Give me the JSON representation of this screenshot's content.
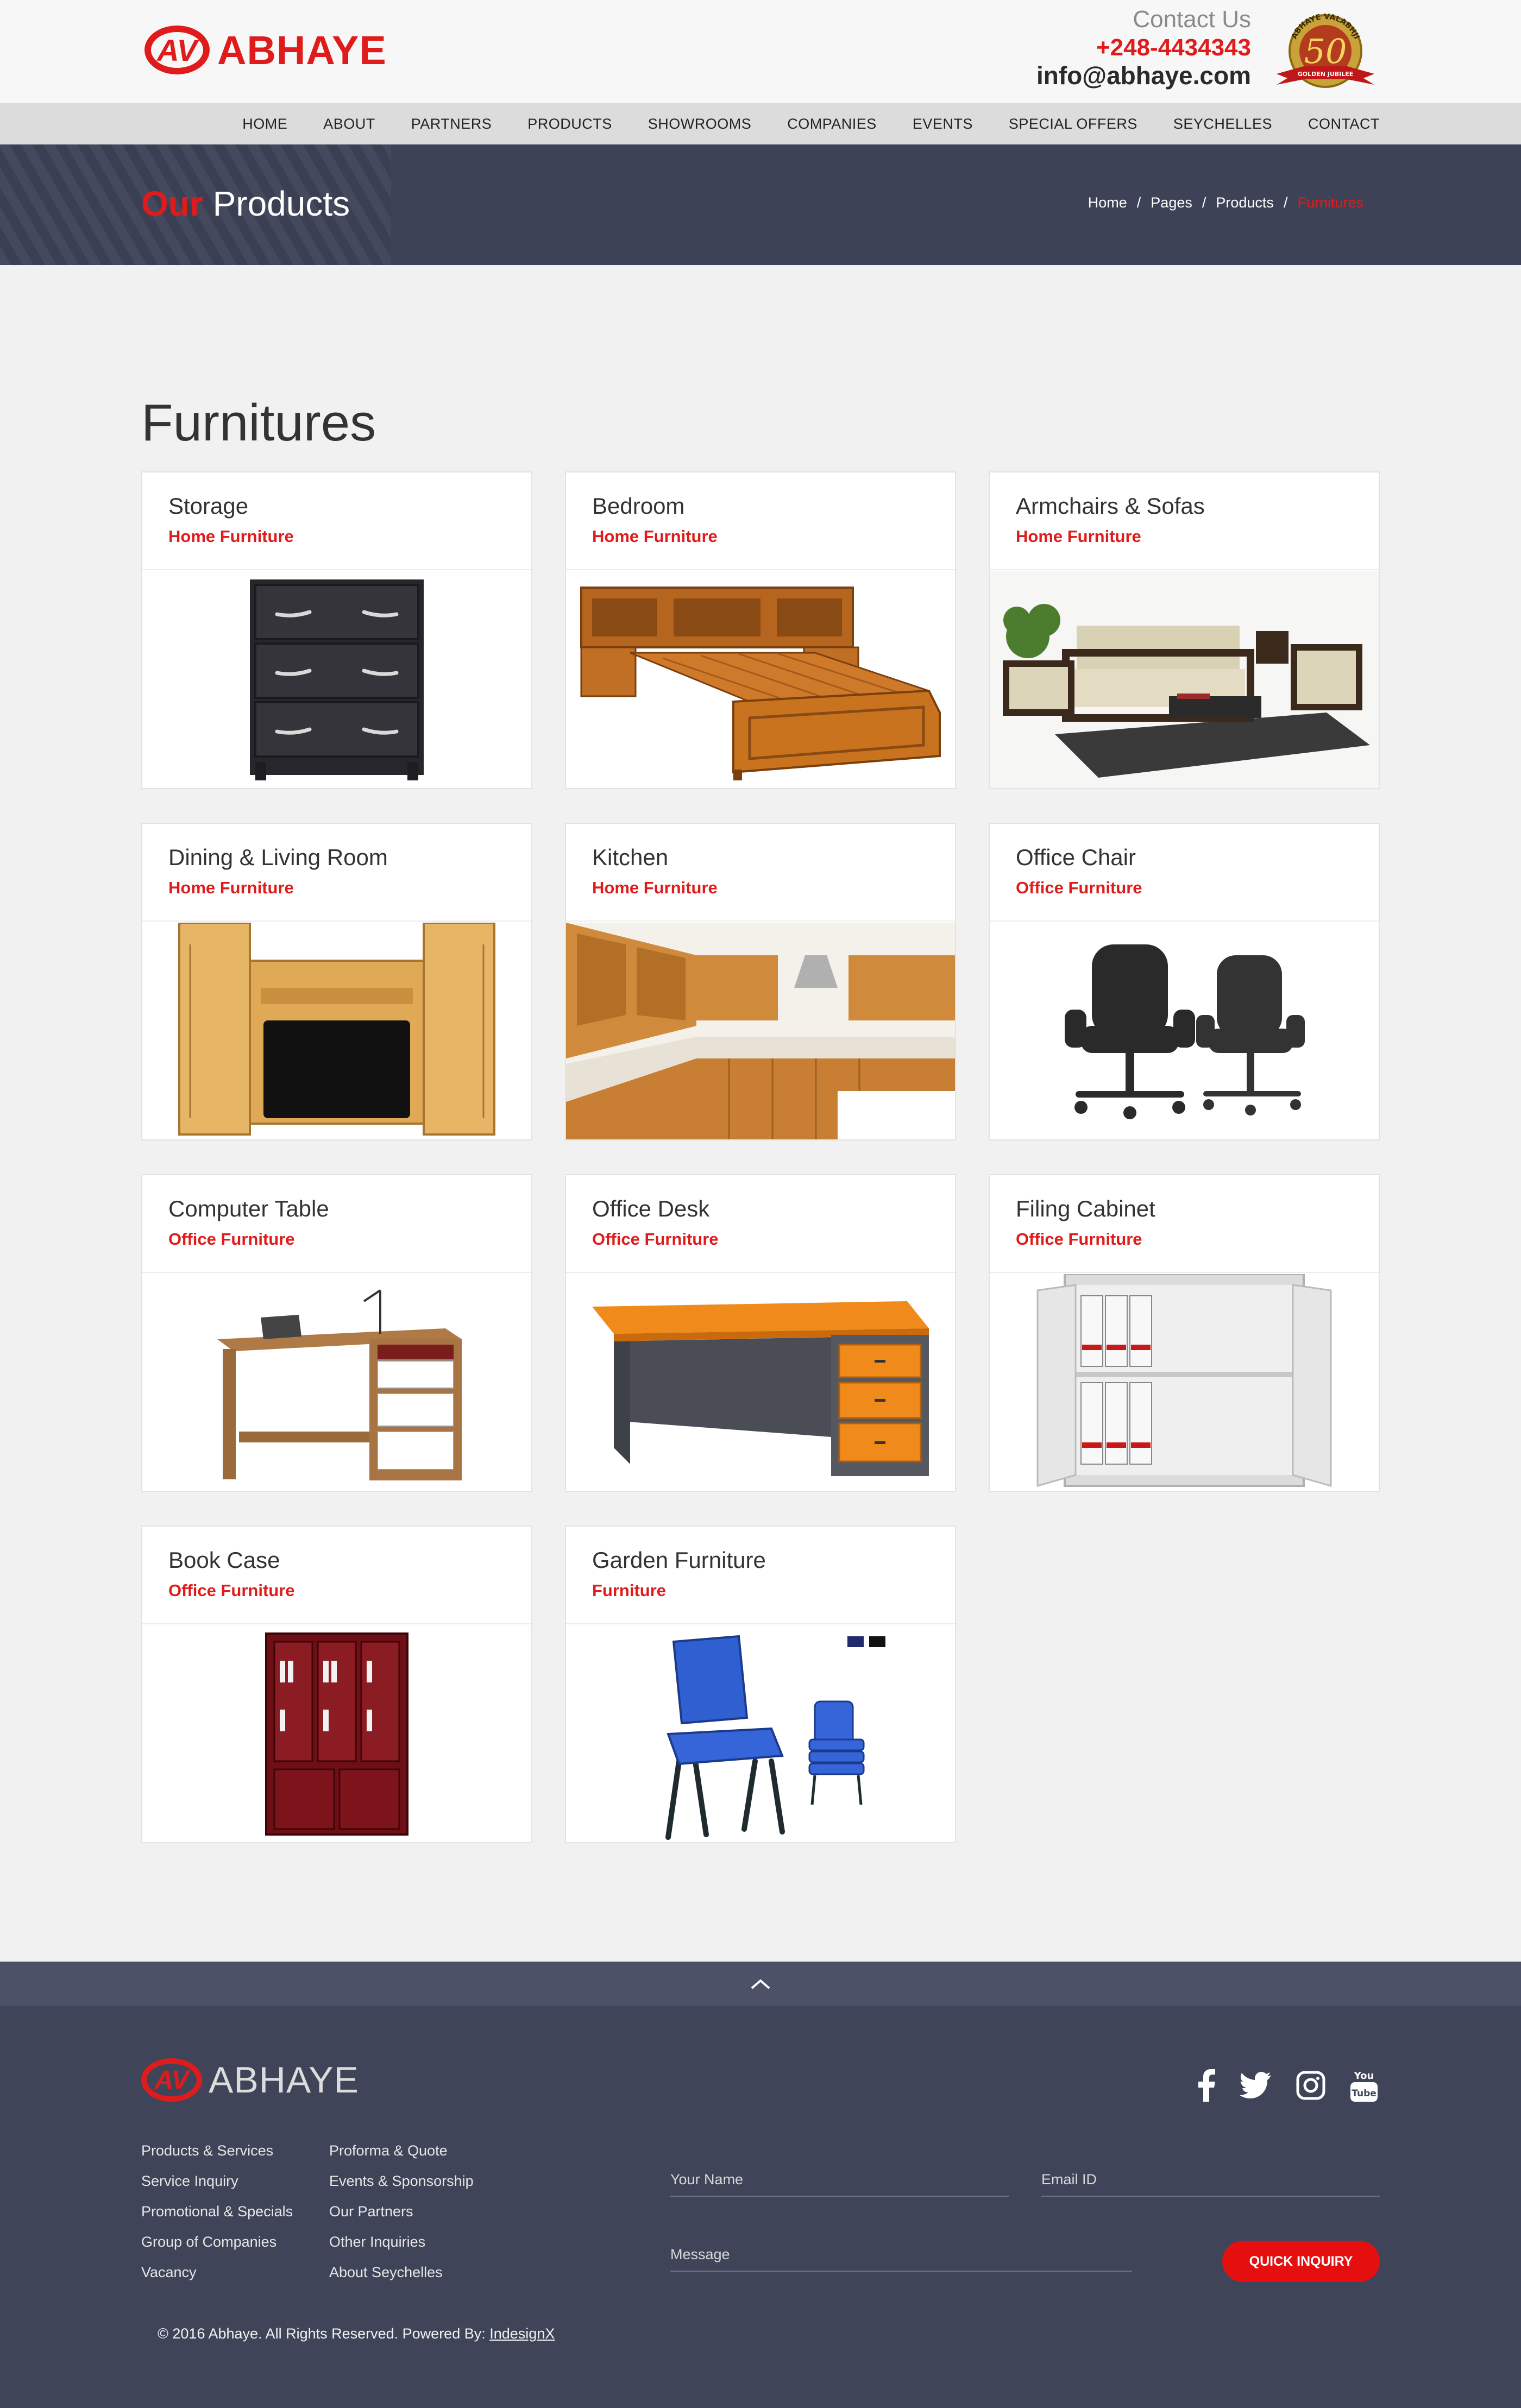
{
  "brand": {
    "name": "ABHAYE",
    "mark": "AV"
  },
  "contact": {
    "title": "Contact Us",
    "phone": "+248-4434343",
    "email": "info@abhaye.com"
  },
  "jubilee": {
    "top": "ABHAYE VALABHJI",
    "number": "50",
    "ribbon": "GOLDEN JUBILEE"
  },
  "nav": [
    "HOME",
    "ABOUT",
    "PARTNERS",
    "PRODUCTS",
    "SHOWROOMS",
    "COMPANIES",
    "EVENTS",
    "SPECIAL OFFERS",
    "SEYCHELLES",
    "CONTACT"
  ],
  "banner": {
    "title_accent": "Our",
    "title_rest": "Products",
    "breadcrumb": [
      "Home",
      "Pages",
      "Products",
      "Furnitures"
    ]
  },
  "section_title": "Furnitures",
  "products": [
    {
      "title": "Storage",
      "category": "Home Furniture",
      "image": "dresser"
    },
    {
      "title": "Bedroom",
      "category": "Home Furniture",
      "image": "bed"
    },
    {
      "title": "Armchairs & Sofas",
      "category": "Home Furniture",
      "image": "sofa-set"
    },
    {
      "title": "Dining & Living Room",
      "category": "Home Furniture",
      "image": "tv-unit"
    },
    {
      "title": "Kitchen",
      "category": "Home Furniture",
      "image": "kitchen"
    },
    {
      "title": "Office Chair",
      "category": "Office Furniture",
      "image": "office-chairs"
    },
    {
      "title": "Computer Table",
      "category": "Office Furniture",
      "image": "computer-table"
    },
    {
      "title": "Office Desk",
      "category": "Office Furniture",
      "image": "office-desk"
    },
    {
      "title": "Filing Cabinet",
      "category": "Office Furniture",
      "image": "filing-cabinet"
    },
    {
      "title": "Book Case",
      "category": "Office Furniture",
      "image": "book-case"
    },
    {
      "title": "Garden Furniture",
      "category": "Furniture",
      "image": "garden-chair"
    }
  ],
  "footer": {
    "links_col1": [
      "Products & Services",
      "Service Inquiry",
      "Promotional & Specials",
      "Group of Companies",
      "Vacancy"
    ],
    "links_col2": [
      "Proforma & Quote",
      "Events & Sponsorship",
      "Our Partners",
      "Other Inquiries",
      "About Seychelles"
    ],
    "social": [
      "facebook-icon",
      "twitter-icon",
      "instagram-icon",
      "youtube-icon"
    ],
    "youtube_label": "You Tube",
    "form": {
      "name_placeholder": "Your Name",
      "email_placeholder": "Email ID",
      "message_placeholder": "Message",
      "submit_label": "QUICK INQUIRY"
    },
    "copyright_text": "© 2016 Abhaye. All Rights Reserved. Powered By:",
    "powered_by": "IndesignX"
  },
  "colors": {
    "accent": "#e01b1b",
    "banner": "#3d4257",
    "footer": "#3f4459"
  }
}
